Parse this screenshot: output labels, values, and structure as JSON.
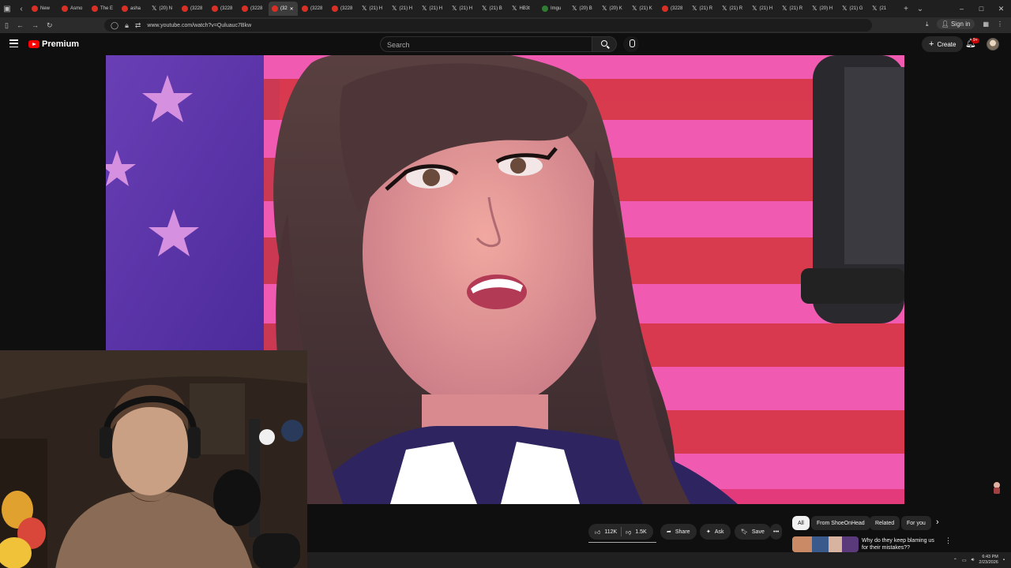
{
  "browser": {
    "tabs": [
      {
        "label": "New",
        "icon": "youtube-icon"
      },
      {
        "label": "Asmo",
        "icon": "youtube-icon"
      },
      {
        "label": "The E",
        "icon": "youtube-icon"
      },
      {
        "label": "asha",
        "icon": "youtube-icon"
      },
      {
        "label": "(20) N",
        "icon": "x-icon"
      },
      {
        "label": "(3228",
        "icon": "youtube-icon"
      },
      {
        "label": "(3228",
        "icon": "youtube-icon"
      },
      {
        "label": "(3228",
        "icon": "youtube-icon"
      },
      {
        "label": "(32",
        "icon": "youtube-icon",
        "active": true
      },
      {
        "label": "(3228",
        "icon": "youtube-icon"
      },
      {
        "label": "(3228",
        "icon": "youtube-icon"
      },
      {
        "label": "(21) H",
        "icon": "x-icon"
      },
      {
        "label": "(21) H",
        "icon": "x-icon"
      },
      {
        "label": "(21) H",
        "icon": "x-icon"
      },
      {
        "label": "(21) H",
        "icon": "x-icon"
      },
      {
        "label": "(21) B",
        "icon": "x-icon"
      },
      {
        "label": "HB3t",
        "icon": "x-icon"
      },
      {
        "label": "Imgu",
        "icon": "image-icon"
      },
      {
        "label": "(20) B",
        "icon": "x-icon"
      },
      {
        "label": "(20) K",
        "icon": "x-icon"
      },
      {
        "label": "(21) K",
        "icon": "x-icon"
      },
      {
        "label": "(3228",
        "icon": "youtube-icon"
      },
      {
        "label": "(21) R",
        "icon": "x-icon"
      },
      {
        "label": "(21) R",
        "icon": "x-icon"
      },
      {
        "label": "(21) H",
        "icon": "x-icon"
      },
      {
        "label": "(21) R",
        "icon": "x-icon"
      },
      {
        "label": "(20) H",
        "icon": "x-icon"
      },
      {
        "label": "(21) G",
        "icon": "x-icon"
      },
      {
        "label": "(21",
        "icon": "x-icon"
      }
    ],
    "new_tab": "+",
    "tab_list": "⌄",
    "window_controls": [
      "–",
      "□",
      "✕"
    ],
    "url": "www.youtube.com/watch?v=Quluauc7Bkw",
    "sign_in": "Sign in"
  },
  "youtube": {
    "logo_text": "Premium",
    "search_placeholder": "Search",
    "create_label": "Create",
    "notification_count": "9+"
  },
  "actions": {
    "likes": "112K",
    "dislikes": "1.5K",
    "share": "Share",
    "ask": "Ask",
    "save": "Save",
    "more": "•••"
  },
  "chips": [
    "All",
    "From ShoeOnHead",
    "Related",
    "For you"
  ],
  "recommendation": {
    "title": "Why do they keep blaming us for their mistakes??"
  },
  "taskbar": {
    "time": "6:43 PM",
    "date": "2/23/2026"
  },
  "colors": {
    "accent": "#ff0000",
    "background": "#0f0f0f",
    "surface": "#272727"
  }
}
